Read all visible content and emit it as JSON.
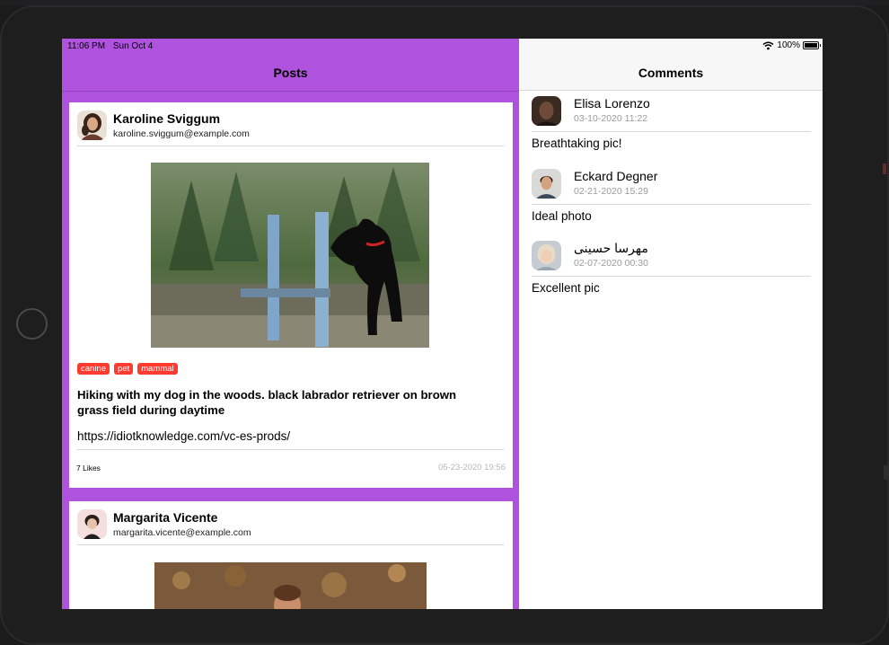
{
  "status_bar": {
    "time": "11:06 PM",
    "date": "Sun Oct 4",
    "battery": "100%",
    "wifi_icon": "wifi-icon",
    "battery_icon": "battery-icon"
  },
  "posts_pane": {
    "title": "Posts",
    "background_color": "#af52de",
    "posts": [
      {
        "author_name": "Karoline Sviggum",
        "author_email": "karoline.sviggum@example.com",
        "tags": [
          "canine",
          "pet",
          "mammal"
        ],
        "caption": "Hiking with my dog in the woods. black labrador retriever on brown grass field during daytime",
        "link": "https://idiotknowledge.com/vc-es-prods/",
        "likes": "7 Likes",
        "date": "05-23-2020 19:56"
      },
      {
        "author_name": "Margarita Vicente",
        "author_email": "margarita.vicente@example.com"
      }
    ]
  },
  "comments_pane": {
    "title": "Comments",
    "comments": [
      {
        "name": "Elisa Lorenzo",
        "timestamp": "03-10-2020 11:22",
        "text": "Breathtaking pic!"
      },
      {
        "name": "Eckard Degner",
        "timestamp": "02-21-2020 15:29",
        "text": "Ideal photo"
      },
      {
        "name": "مهرسا حسینی",
        "timestamp": "02-07-2020 00:30",
        "text": "Excellent pic"
      }
    ]
  },
  "colors": {
    "accent": "#af52de",
    "tag": "#ff3b30"
  }
}
